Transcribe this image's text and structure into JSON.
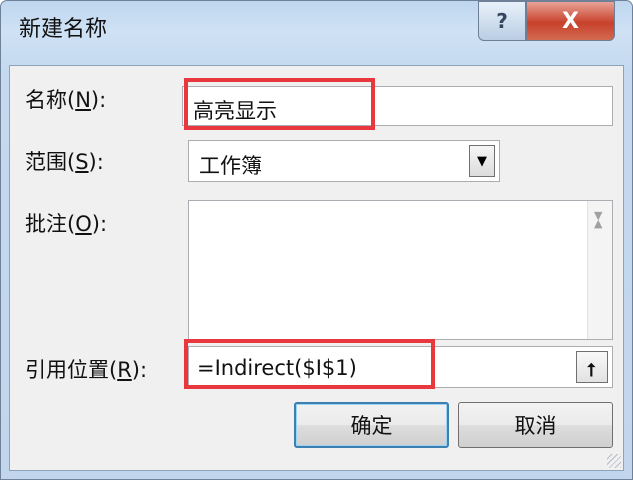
{
  "window": {
    "title": "新建名称",
    "help_glyph": "?",
    "close_glyph": "X"
  },
  "form": {
    "name": {
      "label": "名称",
      "hotkey": "N",
      "suffix": ":",
      "value": "高亮显示"
    },
    "scope": {
      "label": "范围",
      "hotkey": "S",
      "suffix": ":",
      "value": "工作簿",
      "arrow_glyph": "▼"
    },
    "comment": {
      "label": "批注",
      "hotkey": "O",
      "suffix": ":",
      "value": "",
      "scroll_up": "▲",
      "scroll_down": "▼"
    },
    "refers_to": {
      "label": "引用位置",
      "hotkey": "R",
      "suffix": ":",
      "value": "=Indirect($I$1)",
      "collapse_glyph": "⭡"
    }
  },
  "buttons": {
    "ok": "确定",
    "cancel": "取消"
  },
  "colors": {
    "highlight": "#e8383d",
    "close_button": "#c8412b",
    "default_button_border": "#3c7fb1"
  },
  "icons": [
    "help-icon",
    "close-icon",
    "dropdown-arrow-icon",
    "scroll-up-icon",
    "scroll-down-icon",
    "collapse-dialog-icon",
    "resize-grip-icon"
  ]
}
